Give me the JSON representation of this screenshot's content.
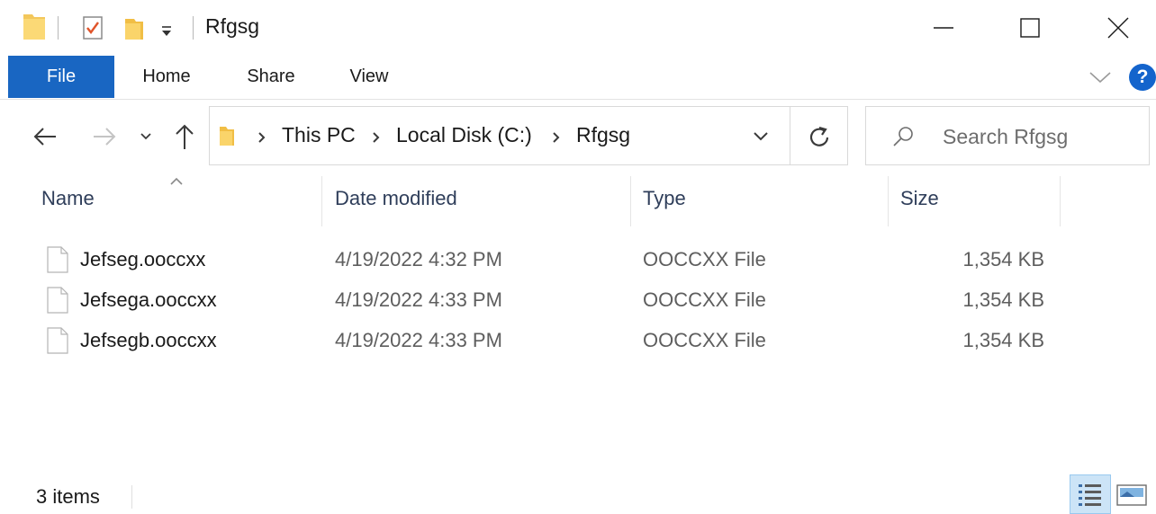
{
  "window": {
    "title": "Rfgsg",
    "folder_icon": "folder-icon",
    "properties_icon": "properties-checkmark-icon",
    "new_folder_icon": "new-folder-icon",
    "customize_icon": "dropdown-arrow-icon"
  },
  "controls": {
    "minimize_icon": "minimize-icon",
    "maximize_icon": "maximize-icon",
    "close_icon": "close-icon"
  },
  "ribbon": {
    "tabs": [
      {
        "label": "File",
        "active": true
      },
      {
        "label": "Home"
      },
      {
        "label": "Share"
      },
      {
        "label": "View"
      }
    ],
    "help_label": "?",
    "accent": "#1966c2"
  },
  "navigation": {
    "back_icon": "back-arrow-icon",
    "forward_icon": "forward-arrow-icon",
    "recent_icon": "chevron-down-icon",
    "up_icon": "up-arrow-icon",
    "breadcrumbs": [
      "This PC",
      "Local Disk (C:)",
      "Rfgsg"
    ],
    "refresh_icon": "refresh-icon",
    "search_placeholder": "Search Rfgsg"
  },
  "file_list": {
    "columns": [
      "Name",
      "Date modified",
      "Type",
      "Size"
    ],
    "sort_column": "Name",
    "rows": [
      {
        "name": "Jefseg.ooccxx",
        "date": "4/19/2022 4:32 PM",
        "type": "OOCCXX File",
        "size": "1,354 KB"
      },
      {
        "name": "Jefsega.ooccxx",
        "date": "4/19/2022 4:33 PM",
        "type": "OOCCXX File",
        "size": "1,354 KB"
      },
      {
        "name": "Jefsegb.ooccxx",
        "date": "4/19/2022 4:33 PM",
        "type": "OOCCXX File",
        "size": "1,354 KB"
      }
    ]
  },
  "status": {
    "item_count": "3 items",
    "details_view_icon": "details-view-icon",
    "large_icons_view_icon": "large-icons-view-icon"
  }
}
